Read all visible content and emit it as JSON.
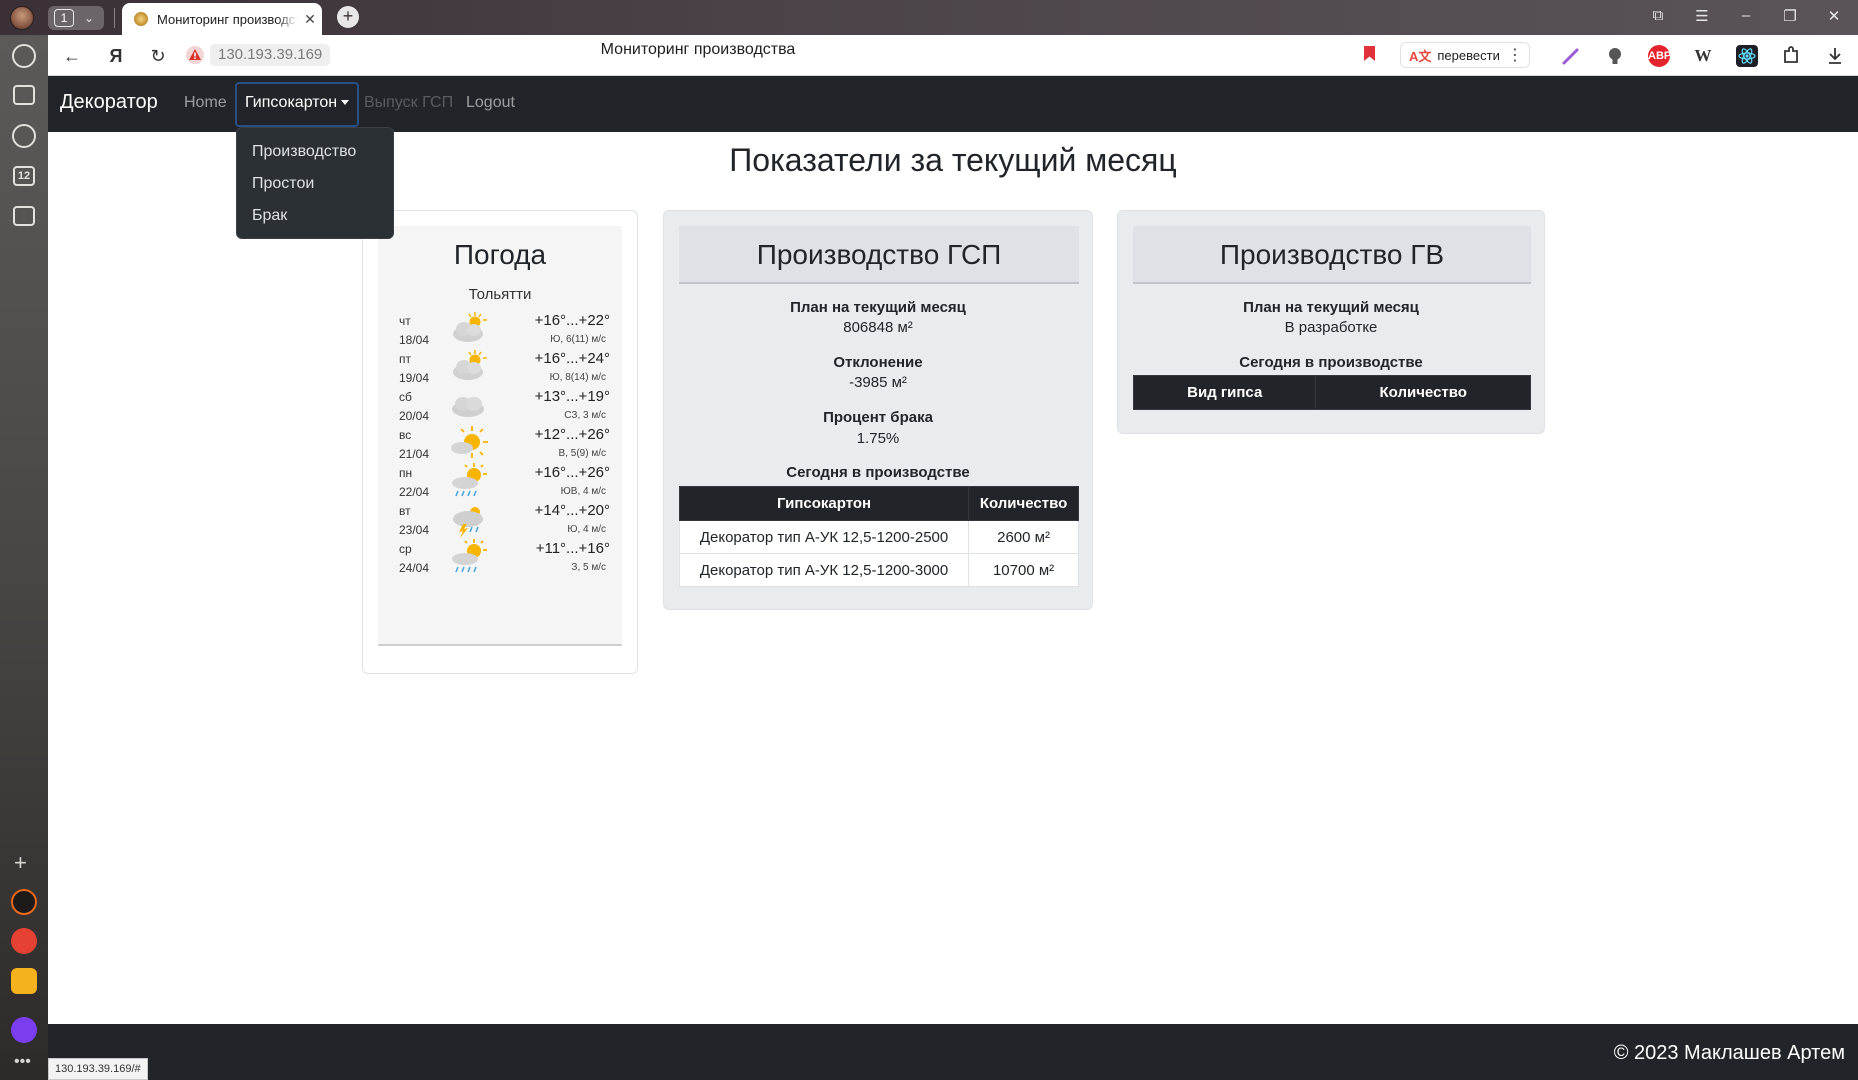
{
  "browser": {
    "tab_count": "1",
    "tab_title": "Мониторинг производства",
    "url": "130.193.39.169",
    "page_title": "Мониторинг производства",
    "translate_label": "перевести",
    "status_url": "130.193.39.169/#",
    "extensions": [
      "pen-icon",
      "lightbulb-icon",
      "adblock-icon",
      "wikipedia-icon",
      "react-devtools-icon",
      "puzzle-icon",
      "download-icon"
    ],
    "side_panel_badge": "12",
    "abp_label": "ABP",
    "wiki_label": "W"
  },
  "navbar": {
    "brand": "Декоратор",
    "links": {
      "home": "Home",
      "gypsum": "Гипсокартон",
      "gsp_output": "Выпуск ГСП",
      "logout": "Logout"
    },
    "dropdown": [
      "Производство",
      "Простои",
      "Брак"
    ]
  },
  "page": {
    "title": "Показатели за текущий месяц"
  },
  "weather": {
    "title": "Погода",
    "city": "Тольятти",
    "days": [
      {
        "day": "чт",
        "date": "18/04",
        "temp": "+16°...+22°",
        "wind": "Ю, 6(11) м/с",
        "icon": "partly-cloudy-icon"
      },
      {
        "day": "пт",
        "date": "19/04",
        "temp": "+16°...+24°",
        "wind": "Ю, 8(14) м/с",
        "icon": "partly-cloudy-icon"
      },
      {
        "day": "сб",
        "date": "20/04",
        "temp": "+13°...+19°",
        "wind": "СЗ, 3 м/с",
        "icon": "cloudy-icon"
      },
      {
        "day": "вс",
        "date": "21/04",
        "temp": "+12°...+26°",
        "wind": "В, 5(9) м/с",
        "icon": "sun-cloud-icon"
      },
      {
        "day": "пн",
        "date": "22/04",
        "temp": "+16°...+26°",
        "wind": "ЮВ, 4 м/с",
        "icon": "sun-rain-icon"
      },
      {
        "day": "вт",
        "date": "23/04",
        "temp": "+14°...+20°",
        "wind": "Ю, 4 м/с",
        "icon": "thunderstorm-icon"
      },
      {
        "day": "ср",
        "date": "24/04",
        "temp": "+11°...+16°",
        "wind": "З, 5 м/с",
        "icon": "sun-rain-icon"
      }
    ]
  },
  "gsp": {
    "title": "Производство ГСП",
    "plan_label": "План на текущий месяц",
    "plan_value": "806848 м²",
    "deviation_label": "Отклонение",
    "deviation_value": "-3985 м²",
    "defect_label": "Процент брака",
    "defect_value": "1.75%",
    "today_label": "Сегодня в производстве",
    "table": {
      "headers": [
        "Гипсокартон",
        "Количество"
      ],
      "rows": [
        [
          "Декоратор тип А-УК 12,5-1200-2500",
          "2600 м²"
        ],
        [
          "Декоратор тип А-УК 12,5-1200-3000",
          "10700 м²"
        ]
      ]
    }
  },
  "gv": {
    "title": "Производство ГВ",
    "plan_label": "План на текущий месяц",
    "plan_value": "В разработке",
    "today_label": "Сегодня в производстве",
    "table": {
      "headers": [
        "Вид гипса",
        "Количество"
      ]
    }
  },
  "footer": {
    "copyright": "© 2023 Маклашев Артем"
  },
  "colors": {
    "navbar_bg": "#212529",
    "card_bg": "#e9ecef",
    "active_outline": "#2a4f84",
    "bookmark": "#e0323a",
    "sun": "#f7b500"
  }
}
